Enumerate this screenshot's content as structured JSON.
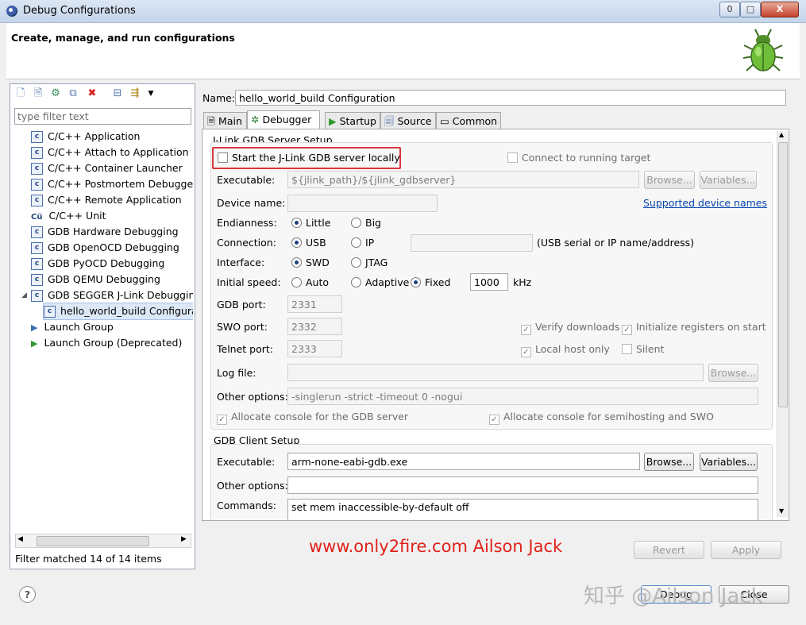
{
  "window": {
    "title": "Debug Configurations",
    "minimize": "0",
    "maximize": "□",
    "close": "X"
  },
  "header": {
    "text": "Create, manage, and run configurations"
  },
  "left": {
    "filter_placeholder": "type filter text",
    "tree": [
      {
        "label": "C/C++ Application",
        "icon": "c"
      },
      {
        "label": "C/C++ Attach to Application",
        "icon": "c"
      },
      {
        "label": "C/C++ Container Launcher",
        "icon": "c"
      },
      {
        "label": "C/C++ Postmortem Debugger",
        "icon": "c"
      },
      {
        "label": "C/C++ Remote Application",
        "icon": "c"
      },
      {
        "label": "C/C++ Unit",
        "icon": "cu"
      },
      {
        "label": "GDB Hardware Debugging",
        "icon": "c"
      },
      {
        "label": "GDB OpenOCD Debugging",
        "icon": "c"
      },
      {
        "label": "GDB PyOCD Debugging",
        "icon": "c"
      },
      {
        "label": "GDB QEMU Debugging",
        "icon": "c"
      },
      {
        "label": "GDB SEGGER J-Link Debugging",
        "icon": "c"
      },
      {
        "label": "hello_world_build Configurat",
        "icon": "c"
      },
      {
        "label": "Launch Group",
        "icon": "launch-group"
      },
      {
        "label": "Launch Group (Deprecated)",
        "icon": "launch"
      }
    ],
    "filter_status": "Filter matched 14 of 14 items"
  },
  "config": {
    "name_label": "Name:",
    "name_value": "hello_world_build Configuration",
    "tabs": [
      "Main",
      "Debugger",
      "Startup",
      "Source",
      "Common"
    ],
    "server": {
      "group_title": "J-Link GDB Server Setup",
      "start_local": "Start the J-Link GDB server locally",
      "connect_running": "Connect to running target",
      "executable_label": "Executable:",
      "executable_value": "${jlink_path}/${jlink_gdbserver}",
      "browse": "Browse...",
      "variables": "Variables...",
      "device_label": "Device name:",
      "supported_link": "Supported device names",
      "endianness_label": "Endianness:",
      "little": "Little",
      "big": "Big",
      "connection_label": "Connection:",
      "usb": "USB",
      "ip": "IP",
      "connection_hint": "(USB serial or IP name/address)",
      "interface_label": "Interface:",
      "swd": "SWD",
      "jtag": "JTAG",
      "speed_label": "Initial speed:",
      "auto": "Auto",
      "adaptive": "Adaptive",
      "fixed": "Fixed",
      "speed_value": "1000",
      "speed_unit": "kHz",
      "gdb_port_label": "GDB port:",
      "gdb_port": "2331",
      "swo_port_label": "SWO port:",
      "swo_port": "2332",
      "telnet_port_label": "Telnet port:",
      "telnet_port": "2333",
      "verify_downloads": "Verify downloads",
      "init_registers": "Initialize registers on start",
      "local_host_only": "Local host only",
      "silent": "Silent",
      "log_label": "Log file:",
      "other_label": "Other options:",
      "other_value": "-singlerun -strict -timeout 0 -nogui",
      "alloc_gdb": "Allocate console for the GDB server",
      "alloc_semi": "Allocate console for semihosting and SWO"
    },
    "client": {
      "group_title": "GDB Client Setup",
      "executable_label": "Executable:",
      "executable_value": "arm-none-eabi-gdb.exe",
      "browse": "Browse...",
      "variables": "Variables...",
      "other_label": "Other options:",
      "commands_label": "Commands:",
      "commands_value": "set mem inaccessible-by-default off"
    },
    "revert": "Revert",
    "apply": "Apply"
  },
  "footer": {
    "overlay_text": "www.only2fire.com  Ailson Jack",
    "help": "?",
    "debug": "Debug",
    "close": "Close",
    "watermark": "知乎 @Ailson Jack"
  }
}
